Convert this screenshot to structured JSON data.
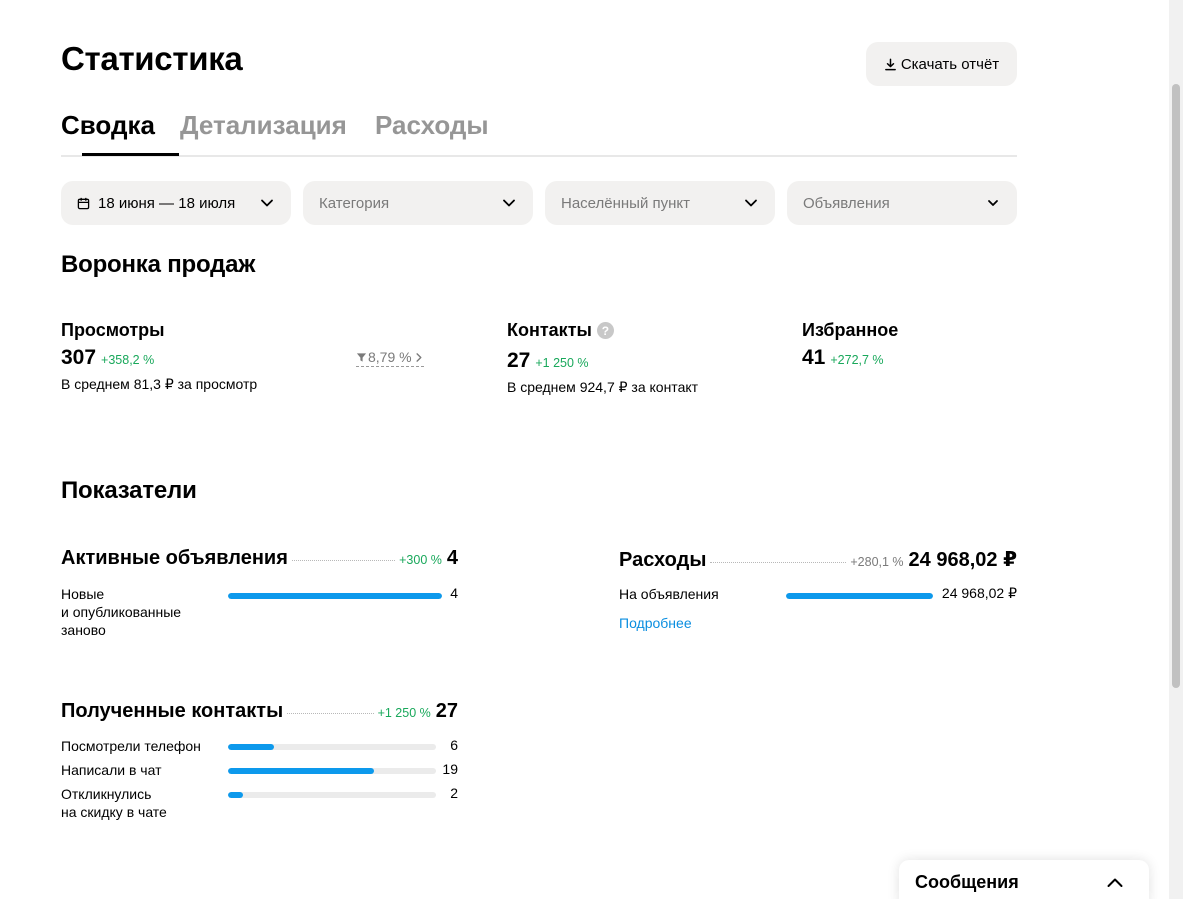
{
  "header": {
    "title": "Статистика",
    "download_label": "Скачать отчёт"
  },
  "tabs": [
    {
      "label": "Сводка",
      "active": true
    },
    {
      "label": "Детализация",
      "active": false
    },
    {
      "label": "Расходы",
      "active": false
    }
  ],
  "filters": {
    "date": "18 июня — 18 июля",
    "category": "Категория",
    "location": "Населённый пункт",
    "ads": "Объявления"
  },
  "funnel": {
    "title": "Воронка продаж",
    "views": {
      "label": "Просмотры",
      "value": "307",
      "change": "+358,2 %",
      "sub": "В среднем 81,3 ₽ за просмотр",
      "conversion": "8,79 %"
    },
    "contacts": {
      "label": "Контакты",
      "value": "27",
      "change": "+1 250 %",
      "sub": "В среднем 924,7 ₽ за контакт"
    },
    "favorites": {
      "label": "Избранное",
      "value": "41",
      "change": "+272,7 %"
    }
  },
  "indicators": {
    "title": "Показатели",
    "active_ads": {
      "name": "Активные объявления",
      "change": "+300 %",
      "value": "4",
      "rows": [
        {
          "label": "Новые\nи опубликованные\nзаново",
          "value": "4",
          "fill": 1.0
        }
      ]
    },
    "expenses": {
      "name": "Расходы",
      "change": "+280,1 %",
      "value": "24 968,02 ₽",
      "rows": [
        {
          "label": "На объявления",
          "value": "24 968,02 ₽",
          "fill": 1.0
        }
      ],
      "more": "Подробнее"
    },
    "contacts": {
      "name": "Полученные контакты",
      "change": "+1 250 %",
      "value": "27",
      "rows": [
        {
          "label": "Посмотрели телефон",
          "value": "6",
          "fill": 0.222
        },
        {
          "label": "Написали в чат",
          "value": "19",
          "fill": 0.704
        },
        {
          "label": "Откликнулись\nна скидку в чате",
          "value": "2",
          "fill": 0.074
        }
      ]
    }
  },
  "messages": {
    "title": "Сообщения"
  },
  "colors": {
    "accent": "#0d99ec",
    "positive": "#19a85b",
    "link": "#0a8ee0",
    "surface": "#f2f1f0"
  }
}
